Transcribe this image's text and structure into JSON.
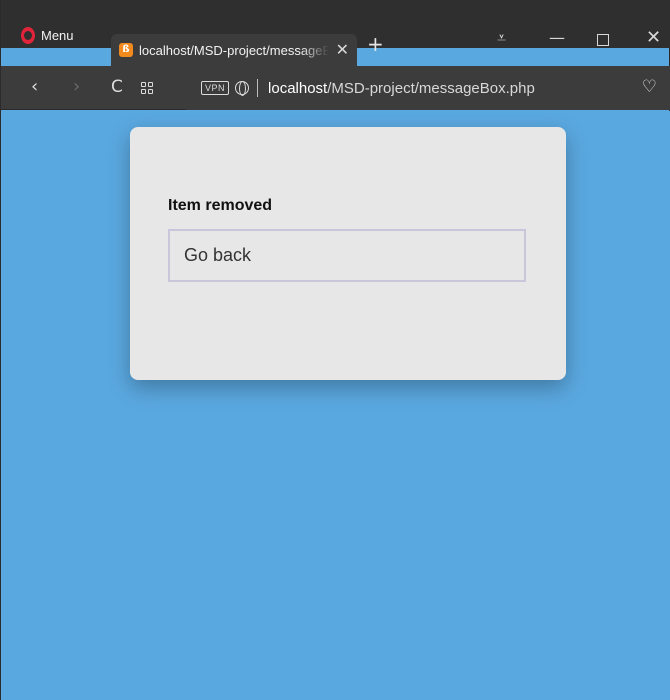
{
  "browser": {
    "menu_label": "Menu",
    "tab": {
      "title": "localhost/MSD-project/messageBox.php",
      "close_glyph": "✕"
    },
    "new_tab_glyph": "+",
    "window_controls": {
      "filter_glyph": "⩡",
      "minimize_glyph": "—",
      "close_glyph": "✕"
    },
    "nav": {
      "back_glyph": "‹",
      "forward_glyph": "›",
      "reload_glyph": "C"
    },
    "address": {
      "vpn_label": "VPN",
      "host": "localhost",
      "path": "/MSD-project/messageBox.php"
    },
    "heart_glyph": "♡",
    "icons": [
      "opera-logo-icon",
      "xampp-icon",
      "close-icon",
      "plus-icon",
      "filter-icon",
      "minimize-icon",
      "maximize-icon",
      "back-icon",
      "forward-icon",
      "reload-icon",
      "speed-dial-icon",
      "globe-icon",
      "heart-icon"
    ]
  },
  "page": {
    "background_color": "#5aa8e0",
    "card": {
      "title": "Item removed",
      "button_label": "Go back"
    }
  }
}
